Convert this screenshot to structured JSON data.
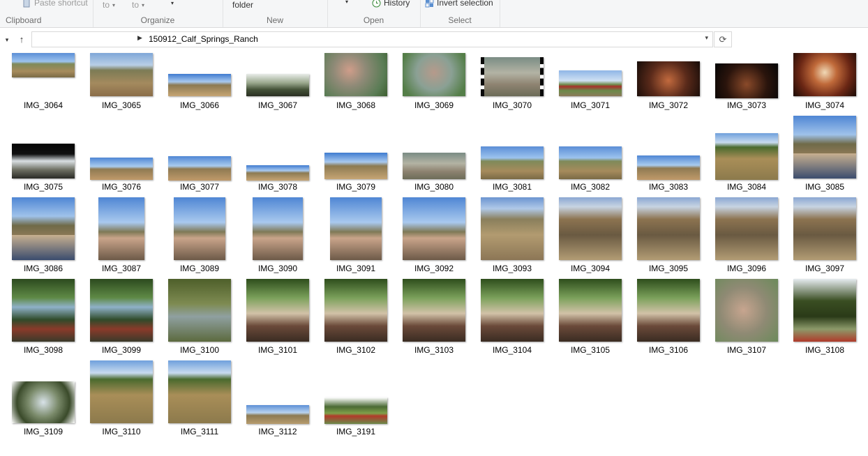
{
  "ribbon": {
    "clipboard": {
      "paste_shortcut": "Paste shortcut",
      "label": "Clipboard"
    },
    "organize": {
      "move_to": "to",
      "copy_to": "to",
      "label": "Organize"
    },
    "new": {
      "new_folder": "folder",
      "label": "New"
    },
    "open": {
      "history": "History",
      "label": "Open"
    },
    "select": {
      "invert_selection": "Invert selection",
      "label": "Select"
    }
  },
  "address": {
    "path": "150912_Calf_Springs_Ranch"
  },
  "files": [
    {
      "name": "IMG_3064",
      "scene": "s-land"
    },
    {
      "name": "IMG_3065",
      "scene": "s-land2"
    },
    {
      "name": "IMG_3066",
      "scene": "s-road"
    },
    {
      "name": "IMG_3067",
      "scene": "s-trees"
    },
    {
      "name": "IMG_3068",
      "scene": "s-water"
    },
    {
      "name": "IMG_3069",
      "scene": "s-water2"
    },
    {
      "name": "IMG_3070",
      "scene": "s-stream"
    },
    {
      "name": "IMG_3071",
      "scene": "s-barn"
    },
    {
      "name": "IMG_3072",
      "scene": "s-inter"
    },
    {
      "name": "IMG_3073",
      "scene": "s-dark"
    },
    {
      "name": "IMG_3074",
      "scene": "s-room"
    },
    {
      "name": "IMG_3075",
      "scene": "s-porch"
    },
    {
      "name": "IMG_3076",
      "scene": "s-pano"
    },
    {
      "name": "IMG_3077",
      "scene": "s-pano"
    },
    {
      "name": "IMG_3078",
      "scene": "s-road"
    },
    {
      "name": "IMG_3079",
      "scene": "s-road"
    },
    {
      "name": "IMG_3080",
      "scene": "s-stream"
    },
    {
      "name": "IMG_3081",
      "scene": "s-land"
    },
    {
      "name": "IMG_3082",
      "scene": "s-land"
    },
    {
      "name": "IMG_3083",
      "scene": "s-pano"
    },
    {
      "name": "IMG_3084",
      "scene": "s-valley"
    },
    {
      "name": "IMG_3085",
      "scene": "s-people"
    },
    {
      "name": "IMG_3086",
      "scene": "s-people"
    },
    {
      "name": "IMG_3087",
      "scene": "s-people2"
    },
    {
      "name": "IMG_3089",
      "scene": "s-people2"
    },
    {
      "name": "IMG_3090",
      "scene": "s-people2"
    },
    {
      "name": "IMG_3091",
      "scene": "s-people2"
    },
    {
      "name": "IMG_3092",
      "scene": "s-people2"
    },
    {
      "name": "IMG_3093",
      "scene": "s-brush"
    },
    {
      "name": "IMG_3094",
      "scene": "s-metal"
    },
    {
      "name": "IMG_3095",
      "scene": "s-metal"
    },
    {
      "name": "IMG_3096",
      "scene": "s-metal"
    },
    {
      "name": "IMG_3097",
      "scene": "s-metal"
    },
    {
      "name": "IMG_3098",
      "scene": "s-river"
    },
    {
      "name": "IMG_3099",
      "scene": "s-river"
    },
    {
      "name": "IMG_3100",
      "scene": "s-pond"
    },
    {
      "name": "IMG_3101",
      "scene": "s-sit"
    },
    {
      "name": "IMG_3102",
      "scene": "s-sit"
    },
    {
      "name": "IMG_3103",
      "scene": "s-sit"
    },
    {
      "name": "IMG_3104",
      "scene": "s-sit"
    },
    {
      "name": "IMG_3105",
      "scene": "s-sit"
    },
    {
      "name": "IMG_3106",
      "scene": "s-sit"
    },
    {
      "name": "IMG_3107",
      "scene": "s-fish"
    },
    {
      "name": "IMG_3108",
      "scene": "s-tree"
    },
    {
      "name": "IMG_3109",
      "scene": "s-fisheye"
    },
    {
      "name": "IMG_3110",
      "scene": "s-valley"
    },
    {
      "name": "IMG_3111",
      "scene": "s-valley"
    },
    {
      "name": "IMG_3112",
      "scene": "s-wide"
    },
    {
      "name": "IMG_3191",
      "scene": "s-cut"
    }
  ]
}
